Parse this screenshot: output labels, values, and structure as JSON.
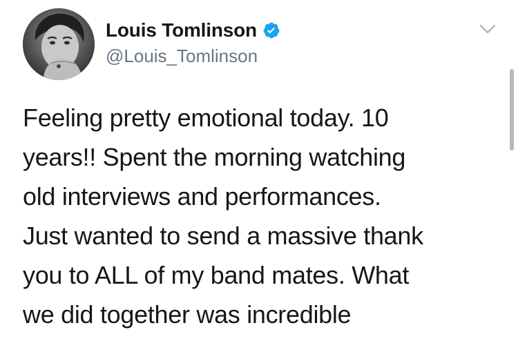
{
  "author": {
    "display_name": "Louis Tomlinson",
    "handle": "@Louis_Tomlinson",
    "verified": true,
    "verified_badge_color": "#1da1f2"
  },
  "tweet": {
    "text": "Feeling pretty emotional today. 10\nyears!! Spent the morning watching\nold interviews and performances.\nJust wanted to send a massive thank\nyou to ALL of my band mates. What\nwe did together was incredible"
  },
  "icons": {
    "verified": "verified-badge-icon",
    "more": "chevron-down-icon"
  },
  "colors": {
    "text": "#14171a",
    "secondary_text": "#657786",
    "chevron": "#aab8c2"
  }
}
